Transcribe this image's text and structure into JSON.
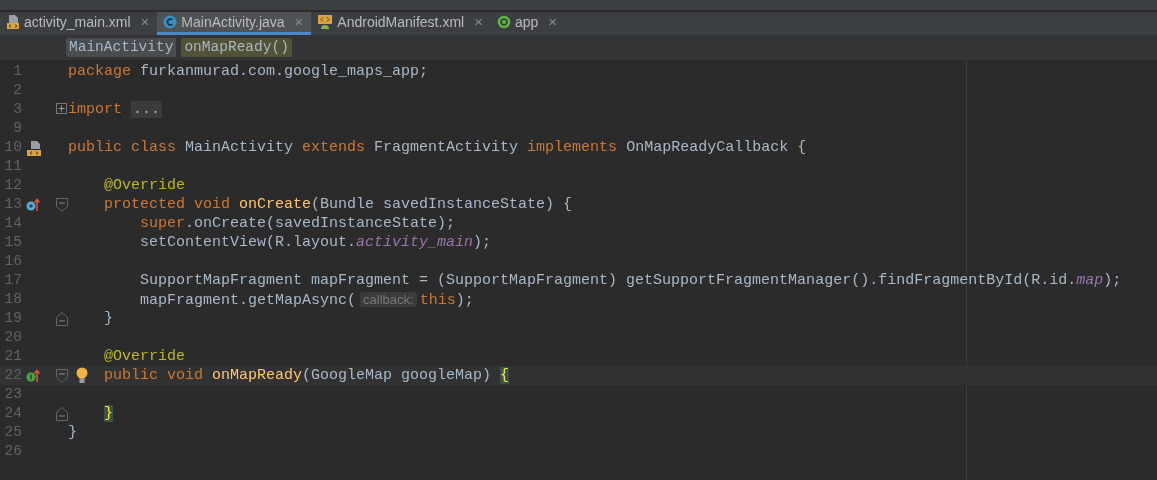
{
  "tabs": [
    {
      "label": "activity_main.xml",
      "kind": "layout",
      "selected": false
    },
    {
      "label": "MainActivity.java",
      "kind": "class",
      "selected": true
    },
    {
      "label": "AndroidManifest.xml",
      "kind": "manifest",
      "selected": false
    },
    {
      "label": "app",
      "kind": "module",
      "selected": false
    }
  ],
  "close_glyph": "×",
  "breadcrumbs": [
    {
      "label": "MainActivity",
      "kind": "class"
    },
    {
      "label": "onMapReady()",
      "kind": "method"
    }
  ],
  "lines": [
    {
      "number": "1",
      "tokens": [
        {
          "text": "package ",
          "kind": "kw"
        },
        {
          "text": "furkanmurad.com.google_maps_app;",
          "kind": "plain"
        }
      ]
    },
    {
      "number": "2"
    },
    {
      "number": "3",
      "fold": {
        "kind": "collapsed"
      },
      "tokens": [
        {
          "text": "import ",
          "kind": "kw"
        },
        {
          "text": "...",
          "kind": "folded"
        }
      ]
    },
    {
      "number": "9"
    },
    {
      "number": "10",
      "gutter": {
        "kind": "layout"
      },
      "tokens": [
        {
          "text": "public class",
          "kind": "kw"
        },
        {
          "text": " MainActivity ",
          "kind": "plain"
        },
        {
          "text": "extends",
          "kind": "kw"
        },
        {
          "text": " FragmentActivity ",
          "kind": "plain"
        },
        {
          "text": "implements",
          "kind": "kw"
        },
        {
          "text": " OnMapReadyCallback {",
          "kind": "plain"
        }
      ]
    },
    {
      "number": "11"
    },
    {
      "number": "12",
      "tokens": [
        {
          "text": "    @Override",
          "kind": "ann"
        }
      ]
    },
    {
      "number": "13",
      "gutter": {
        "kind": "overrides"
      },
      "fold": {
        "kind": "start"
      },
      "tokens": [
        {
          "text": "    protected void ",
          "kind": "kw"
        },
        {
          "text": "onCreate",
          "kind": "fn"
        },
        {
          "text": "(Bundle savedInstanceState) {",
          "kind": "plain"
        }
      ]
    },
    {
      "number": "14",
      "tokens": [
        {
          "text": "        super",
          "kind": "kw"
        },
        {
          "text": ".onCreate(savedInstanceState);",
          "kind": "plain"
        }
      ]
    },
    {
      "number": "15",
      "tokens": [
        {
          "text": "        setContentView(R.layout.",
          "kind": "plain"
        },
        {
          "text": "activity_main",
          "kind": "field"
        },
        {
          "text": ");",
          "kind": "plain"
        }
      ]
    },
    {
      "number": "16"
    },
    {
      "number": "17",
      "tokens": [
        {
          "text": "        SupportMapFragment mapFragment = (SupportMapFragment) getSupportFragmentManager().findFragmentById(R.id.",
          "kind": "plain"
        },
        {
          "text": "map",
          "kind": "field"
        },
        {
          "text": ");",
          "kind": "plain"
        }
      ]
    },
    {
      "number": "18",
      "tokens": [
        {
          "text": "        mapFragment.getMapAsync(",
          "kind": "plain"
        },
        {
          "text": "callback:",
          "kind": "hint"
        },
        {
          "text": "this",
          "kind": "kw"
        },
        {
          "text": ");",
          "kind": "plain"
        }
      ]
    },
    {
      "number": "19",
      "fold": {
        "kind": "end"
      },
      "tokens": [
        {
          "text": "    }",
          "kind": "plain"
        }
      ]
    },
    {
      "number": "20"
    },
    {
      "number": "21",
      "tokens": [
        {
          "text": "    @Override",
          "kind": "ann"
        }
      ]
    },
    {
      "number": "22",
      "gutter": {
        "kind": "implements"
      },
      "fold": {
        "kind": "start"
      },
      "bulb": true,
      "current": true,
      "tokens": [
        {
          "text": "    public void ",
          "kind": "kw"
        },
        {
          "text": "onMapReady",
          "kind": "fn"
        },
        {
          "text": "(GoogleMap googleMap) ",
          "kind": "plain"
        },
        {
          "text": "{",
          "kind": "matched"
        }
      ]
    },
    {
      "number": "23"
    },
    {
      "number": "24",
      "fold": {
        "kind": "end"
      },
      "tokens": [
        {
          "text": "    }",
          "kind": "matched"
        }
      ]
    },
    {
      "number": "25",
      "tokens": [
        {
          "text": "}",
          "kind": "plain"
        }
      ]
    },
    {
      "number": "26"
    }
  ]
}
